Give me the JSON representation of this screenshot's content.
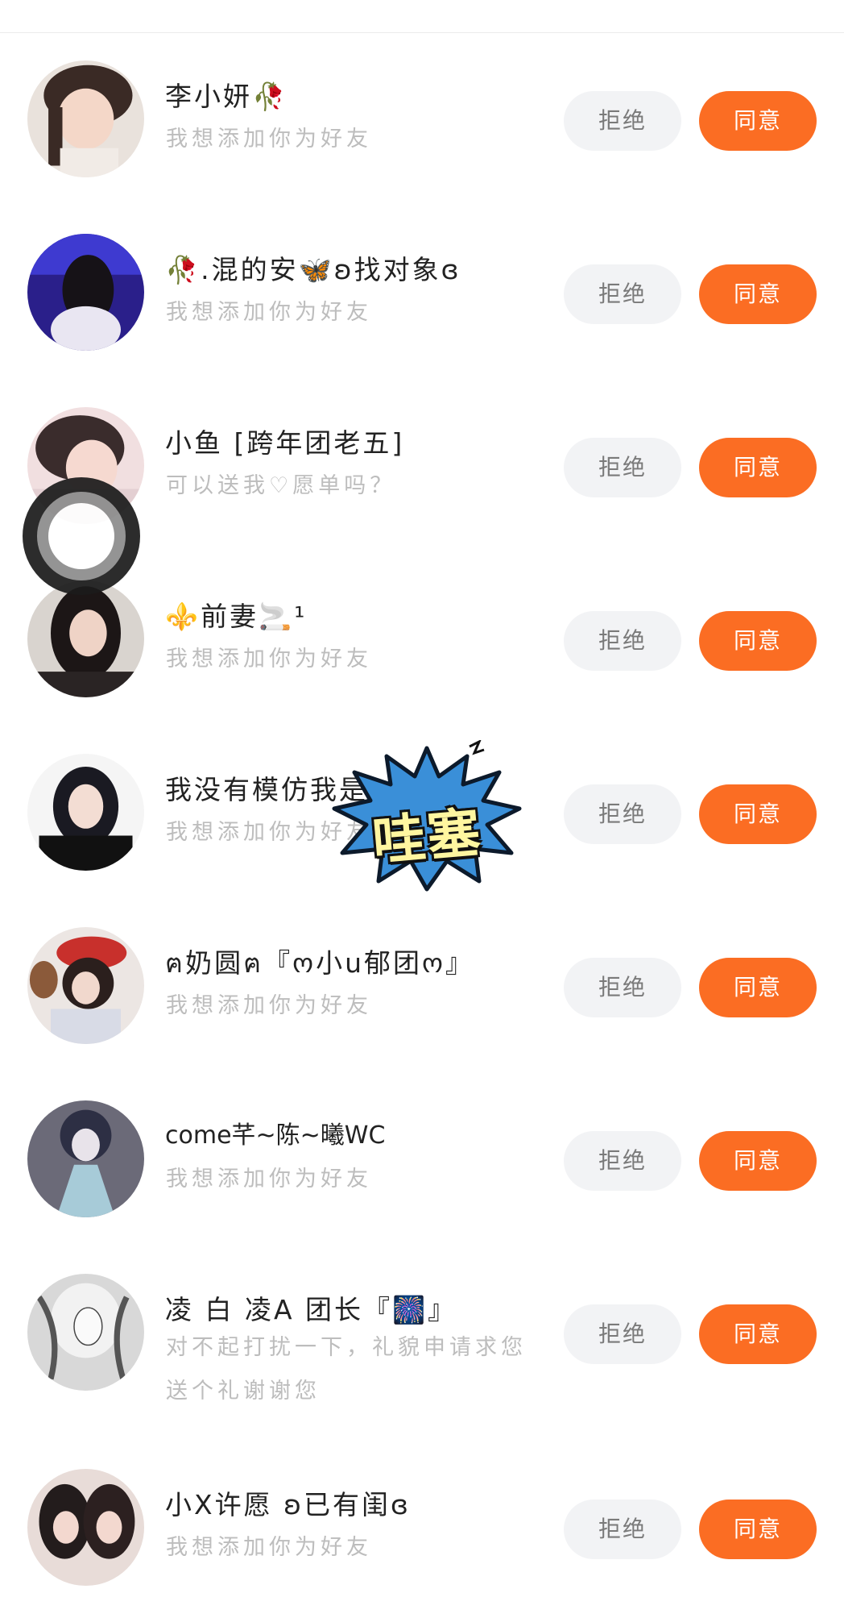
{
  "buttons": {
    "reject": "拒绝",
    "accept": "同意"
  },
  "requests": [
    {
      "name": "李小妍🥀",
      "message": "我想添加你为好友"
    },
    {
      "name": "🥀.混的安🦋ʚ找对象ɞ",
      "message": "我想添加你为好友"
    },
    {
      "name": "小鱼 [跨年团老五]",
      "message": "可以送我♡愿单吗？"
    },
    {
      "name": "⚜️前妻🚬¹",
      "message": "我想添加你为好友"
    },
    {
      "name": "我没有模仿我是…🚬…",
      "message": "我想添加你为好友"
    },
    {
      "name": "ฅ奶圆ฅ『ო小u郁团ო』",
      "message": "我想添加你为好友"
    },
    {
      "name": "come芊~陈~曦WC",
      "message": "我想添加你为好友"
    },
    {
      "name": "凌 白  凌A 团长『🎆』",
      "message": "对不起打扰一下，礼貌申请求您送个礼谢谢您"
    },
    {
      "name": "小X许愿 ʚ已有闺ɞ",
      "message": "我想添加你为好友"
    }
  ],
  "sticker": {
    "text": "哇塞"
  },
  "icons": {
    "assistive_touch": "assistive-touch-icon",
    "sticker": "starburst-sticker"
  },
  "colors": {
    "accept_bg": "#fb6d23",
    "reject_bg": "#f2f3f5",
    "message_text": "#bdbdbd"
  }
}
